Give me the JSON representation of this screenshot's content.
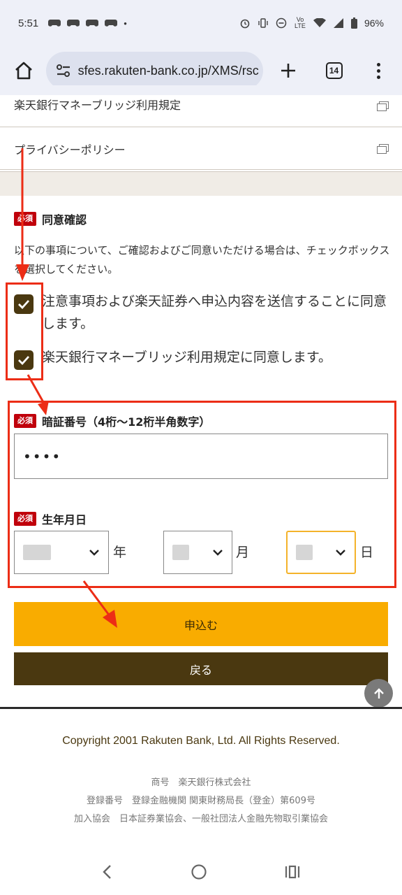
{
  "status_bar": {
    "time": "5:51",
    "battery": "96%",
    "network": "Vo LTE"
  },
  "browser": {
    "url": "sfes.rakuten-bank.co.jp/XMS/rsc",
    "tab_count": "14"
  },
  "policy_links": [
    {
      "label": "楽天銀行マネーブリッジ利用規定"
    },
    {
      "label": "プライバシーポリシー"
    }
  ],
  "consent": {
    "badge": "必須",
    "title": "同意確認",
    "instruction": "以下の事項について、ご確認およびご同意いただける場合は、チェックボックスを選択してください。",
    "checks": [
      {
        "label": "注意事項および楽天証券へ申込内容を送信することに同意します。",
        "checked": true
      },
      {
        "label": "楽天銀行マネーブリッジ利用規定に同意します。",
        "checked": true
      }
    ]
  },
  "pin": {
    "badge": "必須",
    "title": "暗証番号（4桁〜12桁半角数字）",
    "value": "••••"
  },
  "birthdate": {
    "badge": "必須",
    "title": "生年月日",
    "year_unit": "年",
    "month_unit": "月",
    "day_unit": "日"
  },
  "buttons": {
    "apply": "申込む",
    "back": "戻る"
  },
  "footer": {
    "copyright": "Copyright 2001 Rakuten Bank, Ltd. All Rights Reserved.",
    "lines": [
      "商号　楽天銀行株式会社",
      "登録番号　登録金融機関 関東財務局長（登金）第609号",
      "加入協会　日本証券業協会、一般社団法人金融先物取引業協会"
    ]
  },
  "colors": {
    "accent_orange": "#f9ac00",
    "brand_brown": "#4a3810",
    "required_red": "#c0000b",
    "annotation_red": "#ec2d16"
  }
}
